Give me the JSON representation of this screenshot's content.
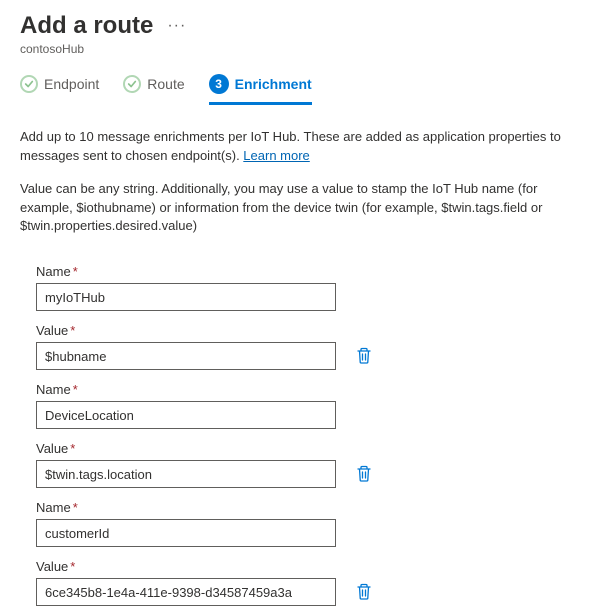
{
  "header": {
    "title": "Add a route",
    "subtitle": "contosoHub"
  },
  "wizard": {
    "steps": [
      {
        "label": "Endpoint",
        "state": "done"
      },
      {
        "label": "Route",
        "state": "done"
      },
      {
        "num": "3",
        "label": "Enrichment",
        "state": "active"
      }
    ]
  },
  "intro": {
    "text_before_link": "Add up to 10 message enrichments per IoT Hub. These are added as application properties to messages sent to chosen endpoint(s). ",
    "link_text": "Learn more"
  },
  "hint": "Value can be any string. Additionally, you may use a value to stamp the IoT Hub name (for example, $iothubname) or information from the device twin (for example, $twin.tags.field or $twin.properties.desired.value)",
  "labels": {
    "name": "Name",
    "value": "Value",
    "required": "*"
  },
  "enrichments": [
    {
      "name": "myIoTHub",
      "value": "$hubname"
    },
    {
      "name": "DeviceLocation",
      "value": "$twin.tags.location"
    },
    {
      "name": "customerId",
      "value": "6ce345b8-1e4a-411e-9398-d34587459a3a"
    }
  ]
}
